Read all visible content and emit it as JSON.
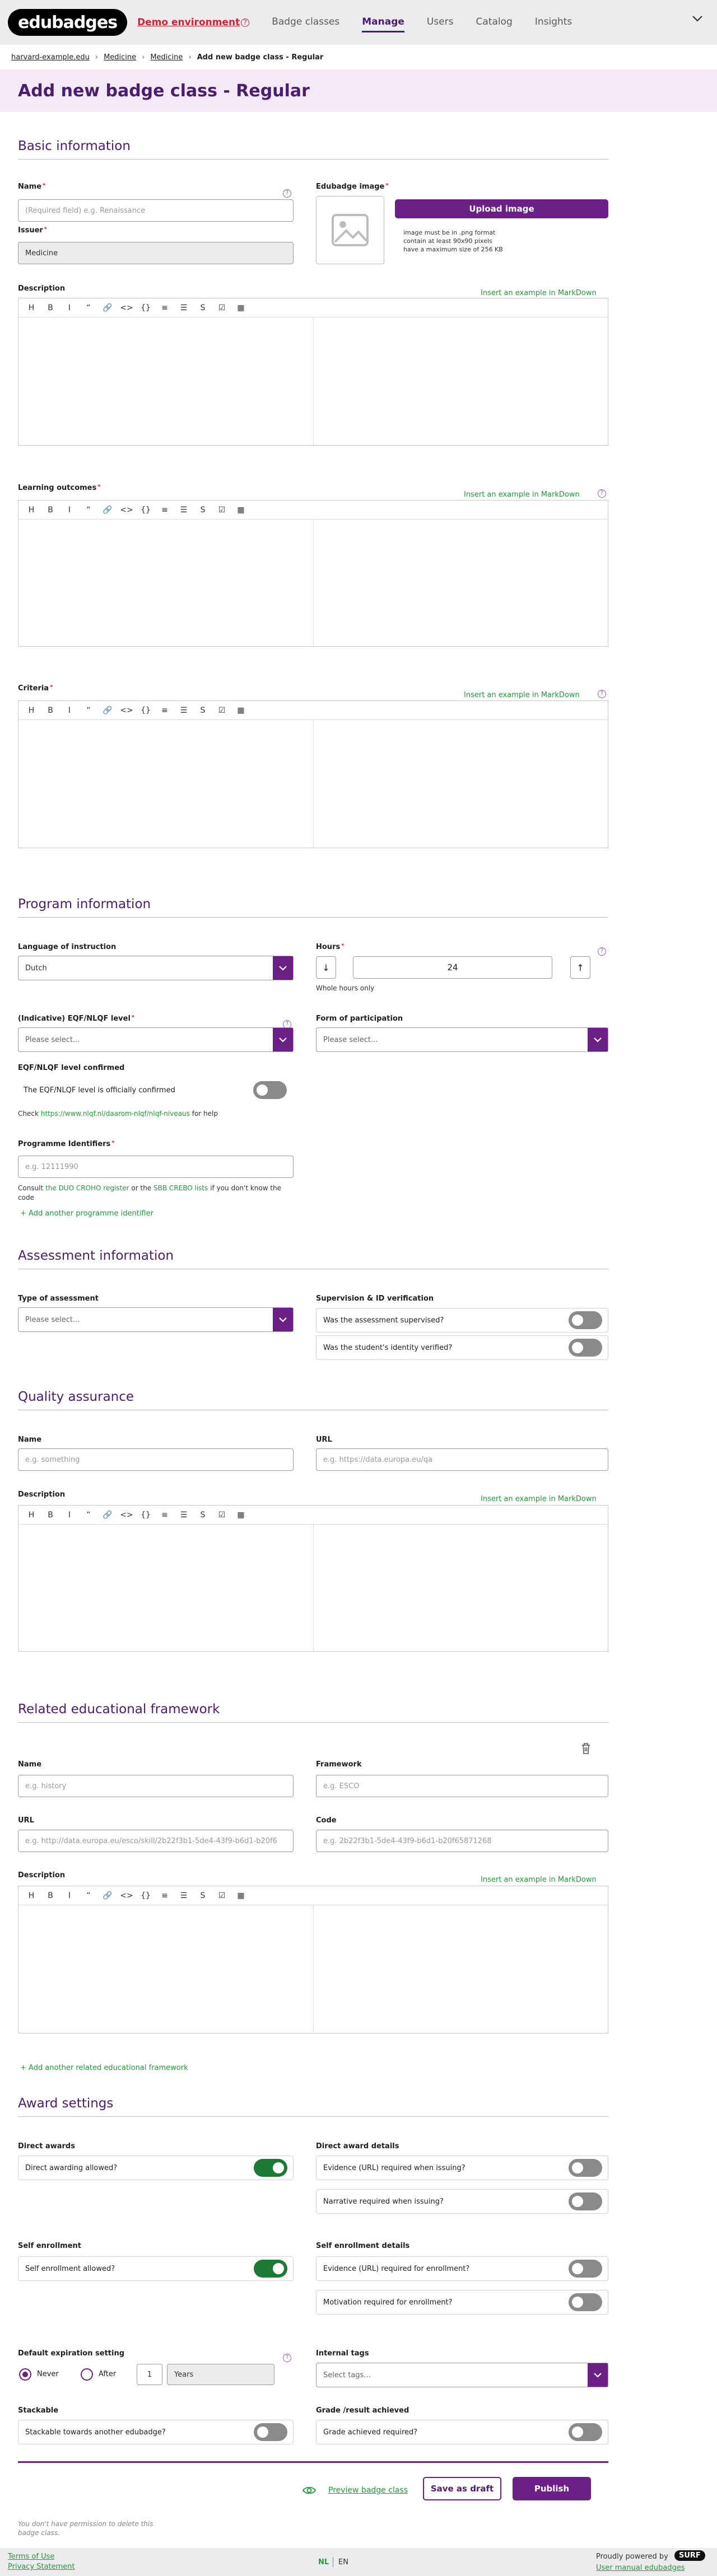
{
  "app": {
    "logo": "edubadges",
    "environment": "Demo environment"
  },
  "nav": [
    "Badge classes",
    "Manage",
    "Users",
    "Catalog",
    "Insights"
  ],
  "breadcrumb": [
    "harvard-example.edu",
    "Medicine",
    "Medicine",
    "Add new badge class - Regular"
  ],
  "page_title": "Add new badge class - Regular",
  "basic": {
    "title": "Basic information",
    "name_label": "Name",
    "name_placeholder": "(Required field) e.g. Renaissance",
    "image_label": "Edubadge image",
    "upload_label": "Upload image",
    "image_rules": [
      "image must be in .png format",
      "contain at least 90x90 pixels",
      "have a maximum size of 256 KB"
    ],
    "issuer_label": "Issuer",
    "issuer_value": "Medicine",
    "description_label": "Description",
    "learning_label": "Learning outcomes",
    "criteria_label": "Criteria",
    "markdown_link": "Insert an example in MarkDown"
  },
  "toolbar_icons": [
    "H",
    "B",
    "I",
    "“",
    "🔗",
    "<>",
    "{}",
    "≡",
    "☰",
    "S",
    "☑",
    "▦"
  ],
  "program": {
    "title": "Program information",
    "language_label": "Language of instruction",
    "language_value": "Dutch",
    "hours_label": "Hours",
    "hours_value": "24",
    "hours_note": "Whole hours only",
    "eqf_label": "(Indicative) EQF/NLQF level",
    "eqf_placeholder": "Please select...",
    "form_label": "Form of participation",
    "form_placeholder": "Please select...",
    "eqf_confirmed_label": "EQF/NLQF level confirmed",
    "eqf_confirmed_text": "The EQF/NLQF level is officially confirmed",
    "check_prefix": "Check",
    "check_link": "https://www.nlqf.nl/daarom-nlqf/nlqf-niveaus",
    "check_suffix": "for help",
    "prog_id_label": "Programme Identifiers",
    "prog_id_placeholder": "e.g. 12111990",
    "consult_1": "Consult",
    "consult_link1": "the DUO CROHO register",
    "consult_2": "or the",
    "consult_link2": "SBB CREBO lists",
    "consult_3": "if you don't know the",
    "consult_4": "code",
    "add_prog_id": "+ Add another programme identifier"
  },
  "assessment": {
    "title": "Assessment information",
    "type_label": "Type of assessment",
    "type_placeholder": "Please select...",
    "supervision_label": "Supervision & ID verification",
    "supervised": "Was the assessment supervised?",
    "verified": "Was the student's identity verified?"
  },
  "quality": {
    "title": "Quality assurance",
    "name_label": "Name",
    "name_placeholder": "e.g. something",
    "url_label": "URL",
    "url_placeholder": "e.g. https://data.europa.eu/qa",
    "description_label": "Description"
  },
  "framework": {
    "title": "Related educational framework",
    "name_label": "Name",
    "name_placeholder": "e.g. history",
    "framework_label": "Framework",
    "framework_placeholder": "e.g. ESCO",
    "url_label": "URL",
    "url_placeholder": "e.g. http://data.europa.eu/esco/skill/2b22f3b1-5de4-43f9-b6d1-b20f6",
    "code_label": "Code",
    "code_placeholder": "e.g. 2b22f3b1-5de4-43f9-b6d1-b20f65871268",
    "description_label": "Description",
    "add_framework": "+ Add another related educational framework"
  },
  "award": {
    "title": "Award settings",
    "direct_label": "Direct awards",
    "direct_text": "Direct awarding allowed?",
    "direct_details_label": "Direct award details",
    "evidence_issue": "Evidence (URL) required when issuing?",
    "narrative_issue": "Narrative required when issuing?",
    "self_label": "Self enrollment",
    "self_text": "Self enrollment allowed?",
    "self_details_label": "Self enrollment details",
    "evidence_enroll": "Evidence (URL) required for enrollment?",
    "motivation_enroll": "Motivation required for enrollment?",
    "expiration_label": "Default expiration setting",
    "never": "Never",
    "after": "After",
    "after_value": "1",
    "after_unit": "Years",
    "tags_label": "Internal tags",
    "tags_placeholder": "Select tags...",
    "stackable_label": "Stackable",
    "stackable_text": "Stackable towards another edubadge?",
    "grade_label": "Grade /result achieved",
    "grade_text": "Grade achieved required?"
  },
  "actions": {
    "preview": "Preview badge class",
    "draft": "Save as draft",
    "publish": "Publish",
    "no_permission": "You don't have permission to delete this badge class."
  },
  "footer": {
    "terms": "Terms of Use",
    "privacy": "Privacy Statement",
    "lang_nl": "NL",
    "lang_en": "EN",
    "powered": "Proudly powered by",
    "surf": "SURF",
    "manual": "User manual edubadges"
  }
}
